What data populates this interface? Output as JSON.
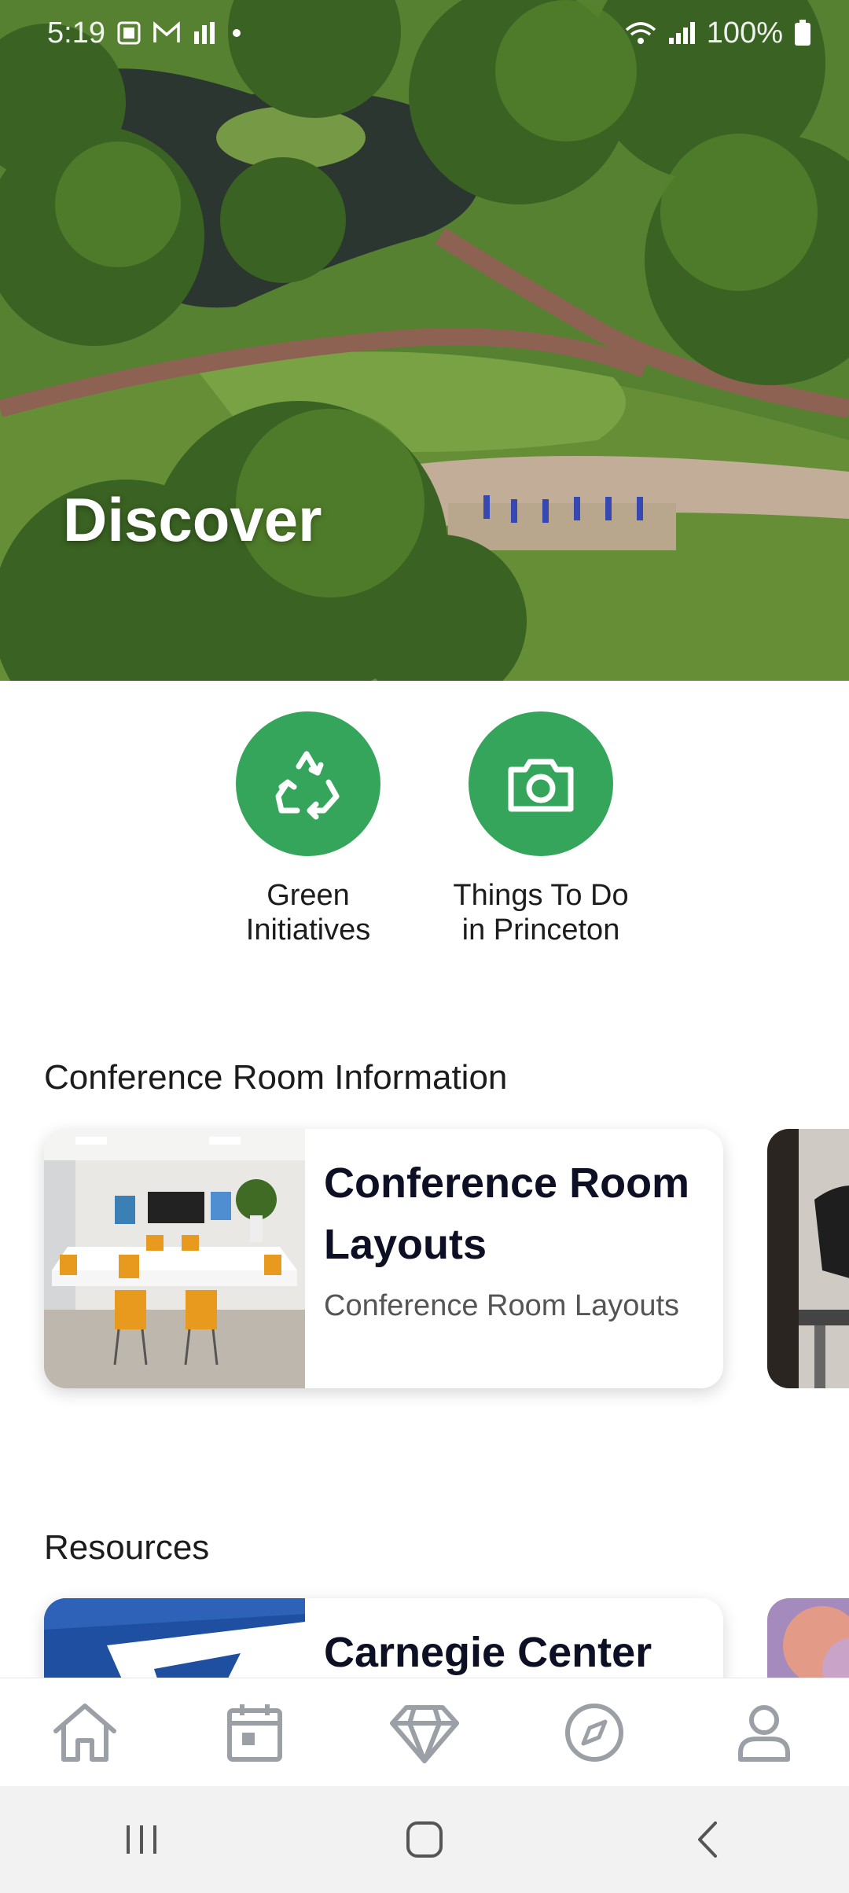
{
  "status_bar": {
    "time": "5:19",
    "battery": "100%"
  },
  "hero": {
    "title": "Discover"
  },
  "quick_actions": [
    {
      "label": "Green\nInitiatives",
      "icon": "recycle-icon"
    },
    {
      "label": "Things To Do\nin Princeton",
      "icon": "camera-icon"
    }
  ],
  "sections": {
    "conference": {
      "title": "Conference Room Information",
      "card": {
        "title": "Conference Room Layouts",
        "subtitle": "Conference Room Layouts"
      }
    },
    "resources": {
      "title": "Resources",
      "card": {
        "title": "Carnegie Center"
      }
    }
  },
  "bottom_nav": [
    "home-icon",
    "calendar-icon",
    "diamond-icon",
    "compass-icon",
    "profile-icon"
  ],
  "system_nav": [
    "recents-icon",
    "home-button-icon",
    "back-icon"
  ],
  "colors": {
    "accent_green": "#34a55a",
    "nav_icon": "#9aa0a6"
  }
}
